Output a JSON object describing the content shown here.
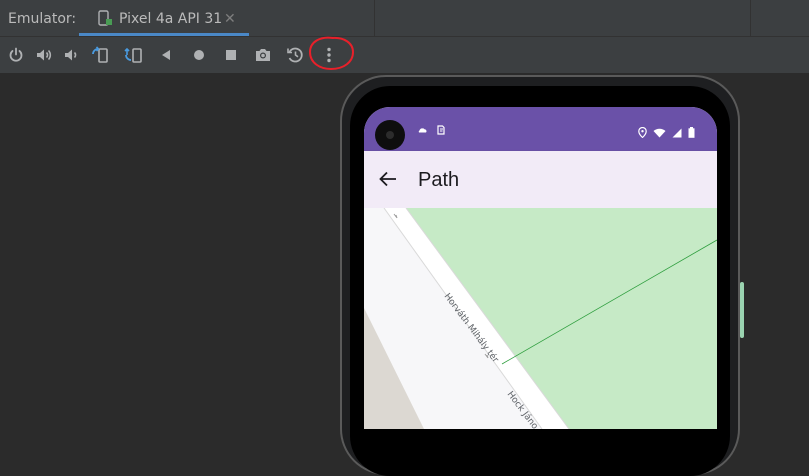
{
  "tabbar": {
    "prefix": "Emulator:",
    "tab_label": "Pixel 4a API 31",
    "close_glyph": "✕"
  },
  "toolbar": {
    "buttons": [
      {
        "name": "power-icon"
      },
      {
        "name": "volume-up-icon"
      },
      {
        "name": "volume-down-icon"
      },
      {
        "name": "rotate-left-icon"
      },
      {
        "name": "rotate-right-icon"
      },
      {
        "name": "back-icon"
      },
      {
        "name": "home-icon"
      },
      {
        "name": "overview-icon"
      },
      {
        "name": "screenshot-icon"
      },
      {
        "name": "snapshot-icon"
      },
      {
        "name": "more-options-icon"
      }
    ],
    "highlight_color": "#e8202a"
  },
  "app": {
    "title": "Path",
    "statusbar_color": "#6a51a8",
    "appbar_color": "#f2ebf7"
  },
  "map": {
    "street_1": "Horváth Mihály tér",
    "street_2": "Hock Jáno",
    "park_color": "#c6eac6",
    "road_color": "#ffffff",
    "building_color": "#dcd8d2",
    "path_color": "#2e9e3e"
  }
}
